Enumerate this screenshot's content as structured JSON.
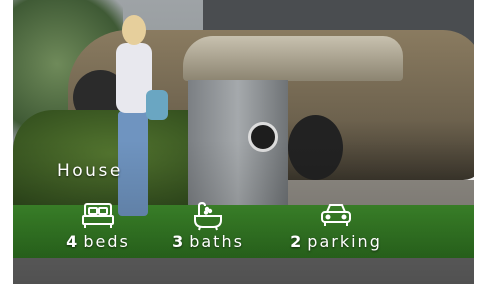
{
  "listing": {
    "type_label": "House",
    "features": [
      {
        "icon": "bed-icon",
        "count": "4",
        "label": "beds"
      },
      {
        "icon": "bath-icon",
        "count": "3",
        "label": "baths"
      },
      {
        "icon": "car-icon",
        "count": "2",
        "label": "parking"
      }
    ]
  }
}
